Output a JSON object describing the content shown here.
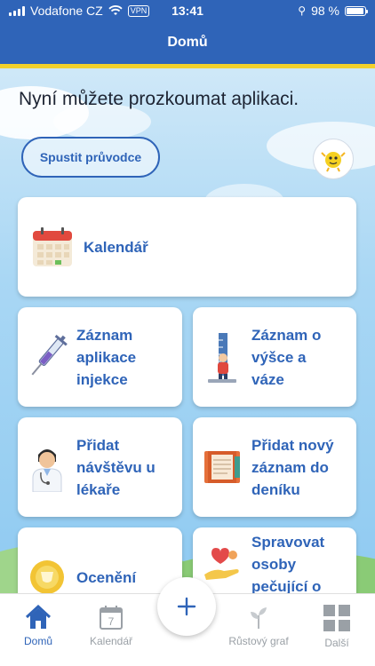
{
  "status_bar": {
    "carrier": "Vodafone CZ",
    "vpn": "VPN",
    "time": "13:41",
    "battery": "98 %"
  },
  "nav": {
    "title": "Domů"
  },
  "intro": "Nyní můžete prozkoumat aplikaci.",
  "guide_button": "Spustit průvodce",
  "cards": {
    "calendar": "Kalendář",
    "injection": "Záznam aplikace injekce",
    "height_weight": "Záznam o výšce a váze",
    "doctor_visit": "Přidat návštěvu u lékaře",
    "diary": "Přidat nový záznam do deníku",
    "awards": "Ocenění",
    "caregivers": "Spravovat osoby pečující o"
  },
  "tabs": {
    "home": "Domů",
    "calendar": "Kalendář",
    "calendar_day": "7",
    "growth": "Růstový graf",
    "more": "Další"
  },
  "fab_icon": "plus-icon",
  "colors": {
    "primary": "#2f64b8",
    "accent_stripe": "#f2d12b",
    "inactive": "#9aa0a6"
  }
}
